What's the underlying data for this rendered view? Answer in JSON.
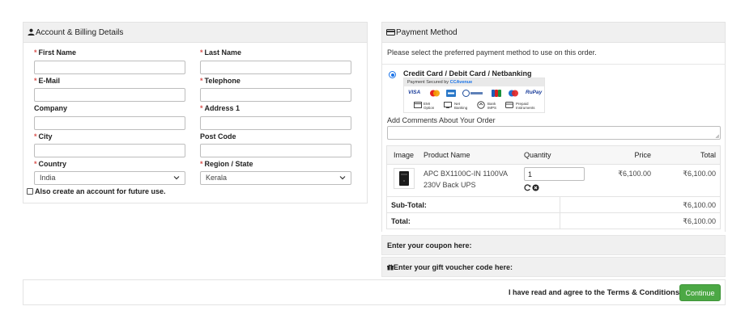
{
  "account": {
    "header": "Account & Billing Details",
    "first_name_label": "First Name",
    "last_name_label": "Last Name",
    "email_label": "E-Mail",
    "telephone_label": "Telephone",
    "company_label": "Company",
    "address1_label": "Address 1",
    "city_label": "City",
    "postcode_label": "Post Code",
    "country_label": "Country",
    "country_value": "India",
    "region_label": "Region / State",
    "region_value": "Kerala",
    "create_account_label": "Also create an account for future use.",
    "required_mark": "*"
  },
  "payment": {
    "header": "Payment Method",
    "instruction": "Please select the preferred payment method to use on this order.",
    "option_label": "Credit Card / Debit Card / Netbanking",
    "secured_by": "Payment Secured by",
    "secured_brand": "CCAvenue",
    "card_logos": [
      "VISA",
      "Mastercard",
      "AMEX",
      "Diners Club",
      "JCB",
      "Maestro",
      "RuPay"
    ],
    "methods": [
      "EMI Option",
      "Net Banking",
      "Bank IMPS",
      "Prepaid Instruments"
    ],
    "comments_label": "Add Comments About Your Order"
  },
  "cart": {
    "headers": {
      "image": "Image",
      "product": "Product Name",
      "quantity": "Quantity",
      "price": "Price",
      "total": "Total"
    },
    "items": [
      {
        "name": "APC BX1100C-IN 1100VA 230V Back UPS",
        "quantity": "1",
        "price": "₹6,100.00",
        "total": "₹6,100.00"
      }
    ],
    "subtotal_label": "Sub-Total:",
    "subtotal_value": "₹6,100.00",
    "total_label": "Total:",
    "total_value": "₹6,100.00"
  },
  "coupon": {
    "label": "Enter your coupon here:"
  },
  "voucher": {
    "label": "Enter your gift voucher code here:"
  },
  "footer": {
    "agree_prefix": "I have read and agree to the",
    "agree_link": "Terms & Conditions",
    "continue_label": "Continue"
  },
  "colors": {
    "accent": "#4ca845",
    "radio": "#1a73e8",
    "required": "#d9534f",
    "panel_header": "#f0f0f0"
  }
}
